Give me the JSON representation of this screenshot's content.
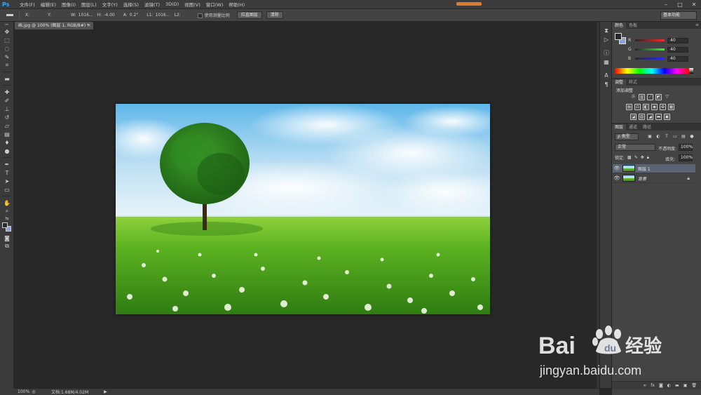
{
  "app": {
    "logo": "Ps"
  },
  "menu": [
    "文件(F)",
    "编辑(E)",
    "图像(I)",
    "图层(L)",
    "文字(Y)",
    "选择(S)",
    "滤镜(T)",
    "3D(D)",
    "视图(V)",
    "窗口(W)",
    "帮助(H)"
  ],
  "window_controls": {
    "minimize": "–",
    "maximize": "□",
    "close": "✕"
  },
  "options": {
    "x_label": "X:",
    "y_label": "Y:",
    "w_label": "W:",
    "w_value": "1016...",
    "h_label": "H:",
    "h_value": "-4.00",
    "a_label": "A:",
    "a_value": "0.2°",
    "l1_label": "L1:",
    "l1_value": "1016...",
    "l2_label": "L2:",
    "use_ruler_label": "使用测量比例",
    "straighten_label": "拉直图层",
    "clear_label": "清除",
    "workspace": "基本功能"
  },
  "document": {
    "tab_title": "画.jpg @ 100% (图层 1, RGB/8#) *",
    "close_glyph": "×"
  },
  "status": {
    "zoom": "100%",
    "doc_info": "文档:1.68M/4.02M",
    "arrow": "▶"
  },
  "tools": [
    "move-tool",
    "marquee-tool",
    "lasso-tool",
    "quick-select-tool",
    "crop-tool",
    "ruler-tool",
    "healing-brush-tool",
    "brush-tool",
    "clone-stamp-tool",
    "history-brush-tool",
    "eraser-tool",
    "gradient-tool",
    "blur-tool",
    "dodge-tool",
    "pen-tool",
    "type-tool",
    "path-select-tool",
    "rectangle-tool",
    "hand-tool",
    "zoom-tool"
  ],
  "color_panel": {
    "tabs": [
      "颜色",
      "色板"
    ],
    "r_label": "R",
    "r_value": "40",
    "g_label": "G",
    "g_value": "40",
    "b_label": "B",
    "b_value": "40",
    "foreground": "#282828",
    "background": "#8fa2d8"
  },
  "adjustments_panel": {
    "tabs": [
      "调整",
      "样式"
    ],
    "title": "添加调整"
  },
  "layers_panel": {
    "tabs": [
      "图层",
      "通道",
      "路径"
    ],
    "filter": "ρ 类型",
    "blend_mode": "正常",
    "opacity_label": "不透明度:",
    "opacity_value": "100%",
    "lock_label": "锁定:",
    "fill_label": "填充:",
    "fill_value": "100%",
    "layers": [
      {
        "name": "图层 1",
        "selected": true
      },
      {
        "name": "背景",
        "selected": false
      }
    ]
  },
  "watermark": {
    "brand": "Baidu",
    "cn": "经验",
    "url": "jingyan.baidu.com"
  }
}
